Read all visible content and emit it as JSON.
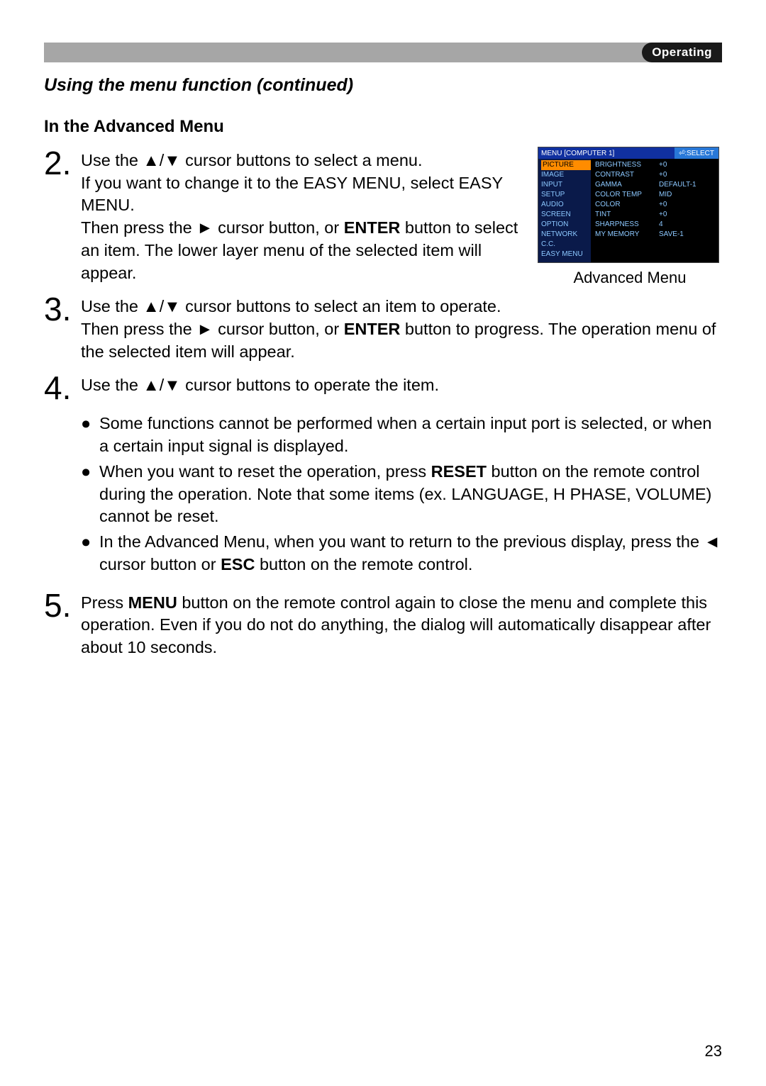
{
  "header": {
    "category": "Operating"
  },
  "section_title": "Using the menu function (continued)",
  "subsection_title": "In the Advanced Menu",
  "steps": {
    "s2": {
      "num": "2.",
      "p1a": "Use the ▲/▼ cursor buttons to select a menu.",
      "p1b": "If you want to change it to the EASY MENU, select EASY MENU.",
      "p1c_a": "Then press the ► cursor button, or ",
      "p1c_enter": "ENTER",
      "p1c_b": " button to select an item. The lower layer menu of the selected item will appear."
    },
    "s3": {
      "num": "3.",
      "p1a": "Use the ▲/▼ cursor buttons to select an item to operate.",
      "p1b_a": "Then press the ► cursor button, or ",
      "p1b_enter": "ENTER",
      "p1b_b": " button to progress. The operation menu of the selected item will appear."
    },
    "s4": {
      "num": "4.",
      "p1": "Use the ▲/▼ cursor buttons to operate the item."
    },
    "s5": {
      "num": "5.",
      "p_a": "Press ",
      "p_menu": "MENU",
      "p_b": " button on the remote control again to close the menu and complete this operation. Even if you do not do anything, the dialog will automatically disappear after about 10 seconds."
    }
  },
  "bullets": {
    "b1": "Some functions cannot be performed when a certain input port is selected, or when a certain input signal is displayed.",
    "b2_a": "When you want to reset the operation, press ",
    "b2_reset": "RESET",
    "b2_b": " button on the remote control during the operation. Note that some items (ex. LANGUAGE, H PHASE, VOLUME) cannot be reset.",
    "b3_a": "In the Advanced Menu, when you want to return to the previous display, press the ◄ cursor button or ",
    "b3_esc": "ESC",
    "b3_b": " button on the remote control."
  },
  "figure": {
    "caption": "Advanced Menu",
    "header_left": "MENU [COMPUTER 1]",
    "header_right": "⏎:SELECT",
    "left_items": [
      "PICTURE",
      "IMAGE",
      "INPUT",
      "SETUP",
      "AUDIO",
      "SCREEN",
      "OPTION",
      "NETWORK",
      "C.C.",
      "EASY MENU"
    ],
    "right_items": [
      {
        "k": "BRIGHTNESS",
        "v": "+0"
      },
      {
        "k": "CONTRAST",
        "v": "+0"
      },
      {
        "k": "GAMMA",
        "v": "DEFAULT-1"
      },
      {
        "k": "COLOR TEMP",
        "v": "MID"
      },
      {
        "k": "COLOR",
        "v": "+0"
      },
      {
        "k": "TINT",
        "v": "+0"
      },
      {
        "k": "SHARPNESS",
        "v": "4"
      },
      {
        "k": "MY MEMORY",
        "v": "SAVE-1"
      }
    ]
  },
  "page_number": "23",
  "glyphs": {
    "bullet": "●"
  }
}
